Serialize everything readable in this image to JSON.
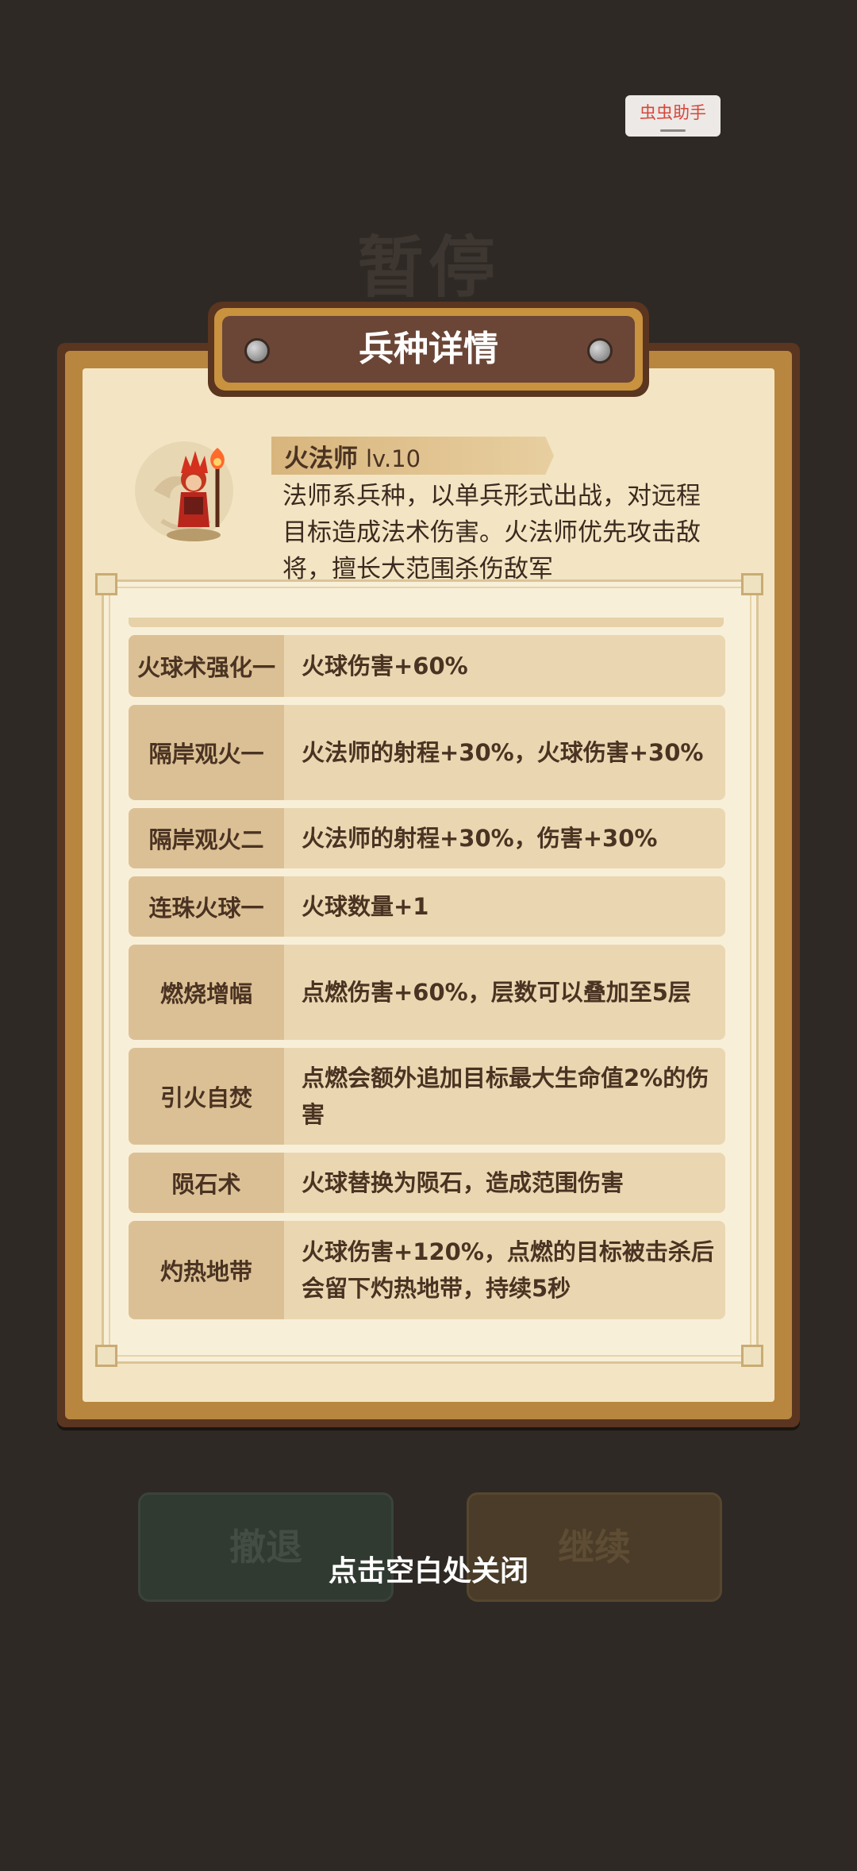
{
  "pause_title": "暂停",
  "helper_button": "虫虫助手",
  "panel_title": "兵种详情",
  "unit": {
    "name": "火法师",
    "level": "lv.10",
    "description": "法师系兵种，以单兵形式出战，对远程目标造成法术伤害。火法师优先攻击敌将，擅长大范围杀伤敌军"
  },
  "upgrades": [
    {
      "name": "火球术强化一",
      "effect": "火球伤害+60%"
    },
    {
      "name": "隔岸观火一",
      "effect": "火法师的射程+30%，火球伤害+30%"
    },
    {
      "name": "隔岸观火二",
      "effect": "火法师的射程+30%，伤害+30%"
    },
    {
      "name": "连珠火球一",
      "effect": "火球数量+1"
    },
    {
      "name": "燃烧增幅",
      "effect": "点燃伤害+60%，层数可以叠加至5层"
    },
    {
      "name": "引火自焚",
      "effect": "点燃会额外追加目标最大生命值2%的伤害"
    },
    {
      "name": "陨石术",
      "effect": "火球替换为陨石，造成范围伤害"
    },
    {
      "name": "灼热地带",
      "effect": "火球伤害+120%，点燃的目标被击杀后会留下灼热地带，持续5秒"
    }
  ],
  "buttons": {
    "retreat": "撤退",
    "continue": "继续"
  },
  "close_hint": "点击空白处关闭"
}
